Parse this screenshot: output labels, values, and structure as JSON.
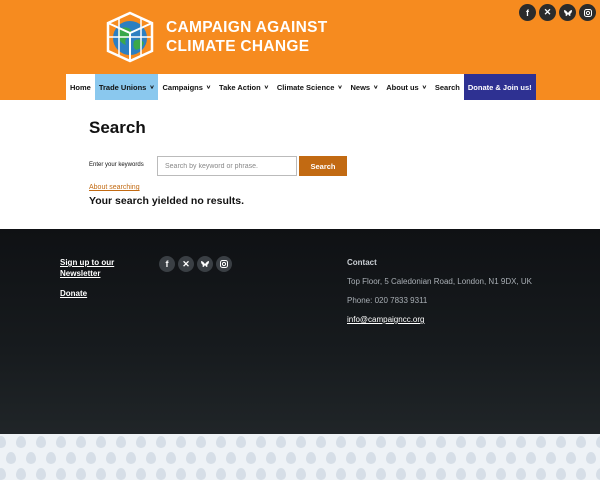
{
  "site": {
    "title_line1": "CAMPAIGN AGAINST",
    "title_line2": "CLIMATE CHANGE",
    "social": [
      {
        "icon": "facebook-icon",
        "glyph": "f"
      },
      {
        "icon": "x-icon",
        "glyph": "𝕏"
      },
      {
        "icon": "bluesky-icon",
        "glyph": "bsky"
      },
      {
        "icon": "instagram-icon",
        "glyph": "ig"
      }
    ]
  },
  "nav": {
    "items": [
      {
        "label": "Home",
        "has_menu": false
      },
      {
        "label": "Trade Unions",
        "has_menu": true,
        "active": true
      },
      {
        "label": "Campaigns",
        "has_menu": true
      },
      {
        "label": "Take Action",
        "has_menu": true
      },
      {
        "label": "Climate Science",
        "has_menu": true
      },
      {
        "label": "News",
        "has_menu": true
      },
      {
        "label": "About us",
        "has_menu": true
      },
      {
        "label": "Search",
        "has_menu": false
      }
    ],
    "donate_label": "Donate & Join us!"
  },
  "search": {
    "title": "Search",
    "keywords_label": "Enter your keywords",
    "placeholder": "Search by keyword or phrase.",
    "button_label": "Search",
    "about_link": "About searching",
    "no_results": "Your search yielded no results."
  },
  "footer": {
    "newsletter_line1": "Sign up to our",
    "newsletter_line2": "Newsletter",
    "donate": "Donate",
    "contact_title": "Contact",
    "address": "Top Floor, 5 Caledonian Road, London, N1 9DX, UK",
    "phone": "Phone: 020 7833 9311",
    "email": "info@campaigncc.org"
  },
  "colors": {
    "header_orange": "#f68b1f",
    "nav_active": "#8ac8ee",
    "donate_navy": "#2e3192",
    "button_orange": "#c26a12",
    "footer_dark": "#15181b"
  }
}
